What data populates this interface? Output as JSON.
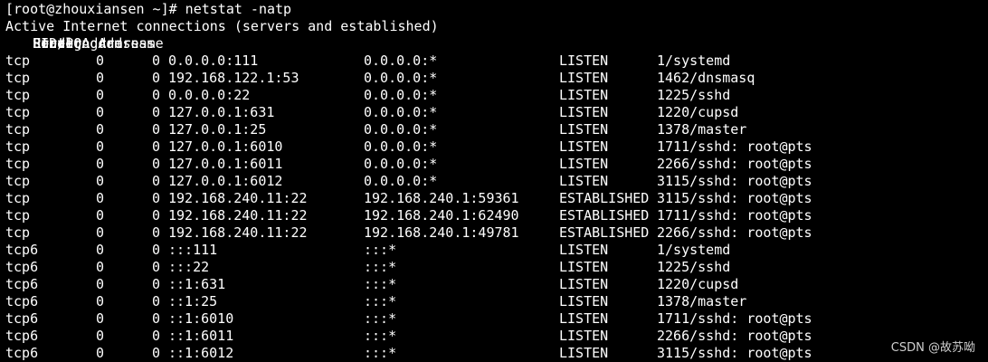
{
  "terminal": {
    "prompt": "[root@zhouxiansen ~]# netstat -natp",
    "info": "Active Internet connections (servers and established)",
    "headers": {
      "proto": "Proto",
      "recvq": "Recv-Q",
      "sendq": "Send-Q",
      "local": "Local Address",
      "foreign": "Foreign Address",
      "state": "State",
      "pid": "PID/Program name"
    },
    "rows": [
      {
        "proto": "tcp",
        "recvq": "0",
        "sendq": "0",
        "local": "0.0.0.0:111",
        "foreign": "0.0.0.0:*",
        "state": "LISTEN",
        "pid": "1/systemd"
      },
      {
        "proto": "tcp",
        "recvq": "0",
        "sendq": "0",
        "local": "192.168.122.1:53",
        "foreign": "0.0.0.0:*",
        "state": "LISTEN",
        "pid": "1462/dnsmasq"
      },
      {
        "proto": "tcp",
        "recvq": "0",
        "sendq": "0",
        "local": "0.0.0.0:22",
        "foreign": "0.0.0.0:*",
        "state": "LISTEN",
        "pid": "1225/sshd"
      },
      {
        "proto": "tcp",
        "recvq": "0",
        "sendq": "0",
        "local": "127.0.0.1:631",
        "foreign": "0.0.0.0:*",
        "state": "LISTEN",
        "pid": "1220/cupsd"
      },
      {
        "proto": "tcp",
        "recvq": "0",
        "sendq": "0",
        "local": "127.0.0.1:25",
        "foreign": "0.0.0.0:*",
        "state": "LISTEN",
        "pid": "1378/master"
      },
      {
        "proto": "tcp",
        "recvq": "0",
        "sendq": "0",
        "local": "127.0.0.1:6010",
        "foreign": "0.0.0.0:*",
        "state": "LISTEN",
        "pid": "1711/sshd: root@pts"
      },
      {
        "proto": "tcp",
        "recvq": "0",
        "sendq": "0",
        "local": "127.0.0.1:6011",
        "foreign": "0.0.0.0:*",
        "state": "LISTEN",
        "pid": "2266/sshd: root@pts"
      },
      {
        "proto": "tcp",
        "recvq": "0",
        "sendq": "0",
        "local": "127.0.0.1:6012",
        "foreign": "0.0.0.0:*",
        "state": "LISTEN",
        "pid": "3115/sshd: root@pts"
      },
      {
        "proto": "tcp",
        "recvq": "0",
        "sendq": "0",
        "local": "192.168.240.11:22",
        "foreign": "192.168.240.1:59361",
        "state": "ESTABLISHED",
        "pid": "3115/sshd: root@pts"
      },
      {
        "proto": "tcp",
        "recvq": "0",
        "sendq": "0",
        "local": "192.168.240.11:22",
        "foreign": "192.168.240.1:62490",
        "state": "ESTABLISHED",
        "pid": "1711/sshd: root@pts"
      },
      {
        "proto": "tcp",
        "recvq": "0",
        "sendq": "0",
        "local": "192.168.240.11:22",
        "foreign": "192.168.240.1:49781",
        "state": "ESTABLISHED",
        "pid": "2266/sshd: root@pts"
      },
      {
        "proto": "tcp6",
        "recvq": "0",
        "sendq": "0",
        "local": ":::111",
        "foreign": ":::*",
        "state": "LISTEN",
        "pid": "1/systemd"
      },
      {
        "proto": "tcp6",
        "recvq": "0",
        "sendq": "0",
        "local": ":::22",
        "foreign": ":::*",
        "state": "LISTEN",
        "pid": "1225/sshd"
      },
      {
        "proto": "tcp6",
        "recvq": "0",
        "sendq": "0",
        "local": "::1:631",
        "foreign": ":::*",
        "state": "LISTEN",
        "pid": "1220/cupsd"
      },
      {
        "proto": "tcp6",
        "recvq": "0",
        "sendq": "0",
        "local": "::1:25",
        "foreign": ":::*",
        "state": "LISTEN",
        "pid": "1378/master"
      },
      {
        "proto": "tcp6",
        "recvq": "0",
        "sendq": "0",
        "local": "::1:6010",
        "foreign": ":::*",
        "state": "LISTEN",
        "pid": "1711/sshd: root@pts"
      },
      {
        "proto": "tcp6",
        "recvq": "0",
        "sendq": "0",
        "local": "::1:6011",
        "foreign": ":::*",
        "state": "LISTEN",
        "pid": "2266/sshd: root@pts"
      },
      {
        "proto": "tcp6",
        "recvq": "0",
        "sendq": "0",
        "local": "::1:6012",
        "foreign": ":::*",
        "state": "LISTEN",
        "pid": "3115/sshd: root@pts"
      }
    ]
  },
  "watermark": "CSDN @故苏呦",
  "colors": {
    "background": "#000000",
    "text": "#ffffff"
  }
}
